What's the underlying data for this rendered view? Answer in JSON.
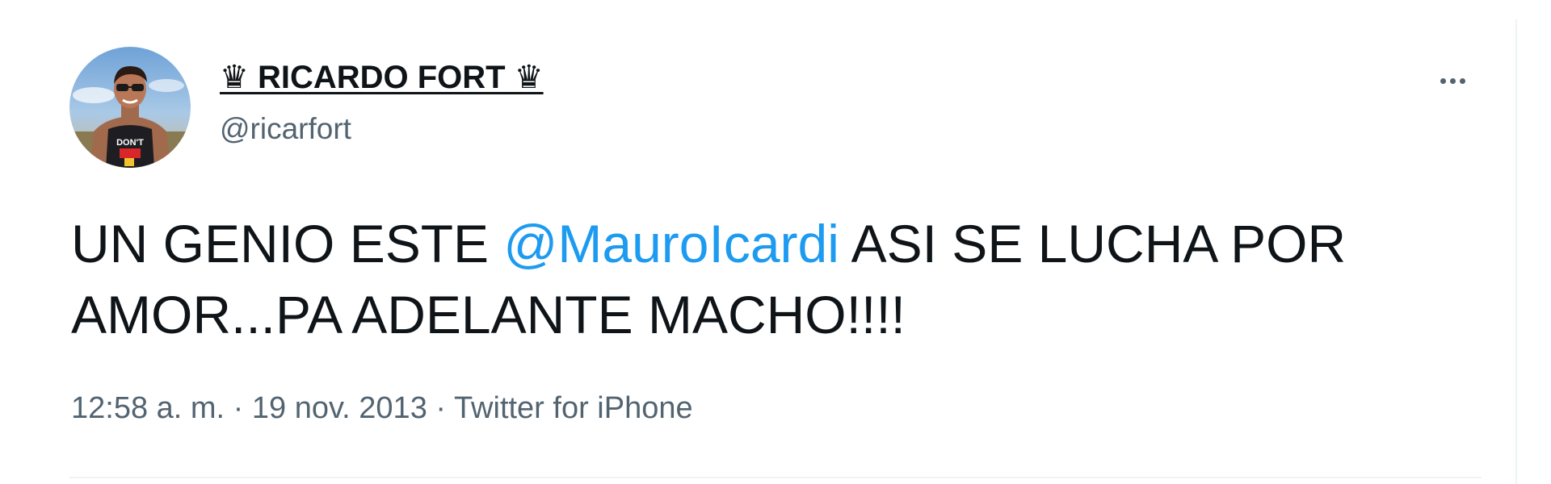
{
  "author": {
    "display_name": "♛ RICARDO FORT ♛",
    "handle": "@ricarfort"
  },
  "tweet": {
    "text_before_mention": "UN GENIO ESTE ",
    "mention": "@MauroIcardi",
    "text_after_mention_line1": " ASI SE LUCHA POR",
    "text_line2": "AMOR...PA ADELANTE MACHO!!!!"
  },
  "meta": {
    "time": "12:58 a. m.",
    "separator": " · ",
    "date": "19 nov. 2013",
    "source": "Twitter for iPhone"
  },
  "icons": {
    "more": "more-horizontal-icon"
  },
  "colors": {
    "mention": "#1d9bf0",
    "secondary_text": "#536471",
    "primary_text": "#0f1419",
    "border": "#eff3f4"
  }
}
